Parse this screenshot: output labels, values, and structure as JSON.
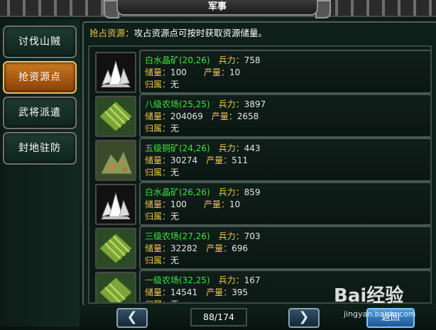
{
  "title": "军事",
  "sidebar": {
    "items": [
      {
        "label": "讨伐山贼",
        "active": false
      },
      {
        "label": "抢资源点",
        "active": true
      },
      {
        "label": "武将派遣",
        "active": false
      },
      {
        "label": "封地驻防",
        "active": false
      }
    ]
  },
  "intro": {
    "highlight": "抢占资源：",
    "text": "攻占资源点可按时获取资源储量。"
  },
  "labels": {
    "troops": "兵力：",
    "reserve": "储量：",
    "output": "产量：",
    "owner": "归属："
  },
  "resources": [
    {
      "name": "白水晶矿(20,26)",
      "troops": "758",
      "reserve": "100",
      "output": "10",
      "owner": "无",
      "icon": "crystal-icon"
    },
    {
      "name": "八级农场(25,25)",
      "troops": "3897",
      "reserve": "204069",
      "output": "2658",
      "owner": "无",
      "icon": "farm-icon"
    },
    {
      "name": "五级铜矿(24,26)",
      "troops": "443",
      "reserve": "30274",
      "output": "511",
      "owner": "无",
      "icon": "copper-mine-icon"
    },
    {
      "name": "白水晶矿(26,26)",
      "troops": "859",
      "reserve": "100",
      "output": "10",
      "owner": "无",
      "icon": "crystal-icon"
    },
    {
      "name": "三级农场(27,26)",
      "troops": "703",
      "reserve": "32282",
      "output": "696",
      "owner": "无",
      "icon": "farm-icon"
    },
    {
      "name": "一级农场(32,25)",
      "troops": "167",
      "reserve": "14541",
      "output": "395",
      "owner": "无",
      "icon": "farm-icon"
    }
  ],
  "pagination": {
    "page": "88/174",
    "prev": "❮",
    "next": "❯"
  },
  "back_button": "返回",
  "watermark": {
    "logo": "Bai经验",
    "url": "jingyan.baidu.com"
  }
}
